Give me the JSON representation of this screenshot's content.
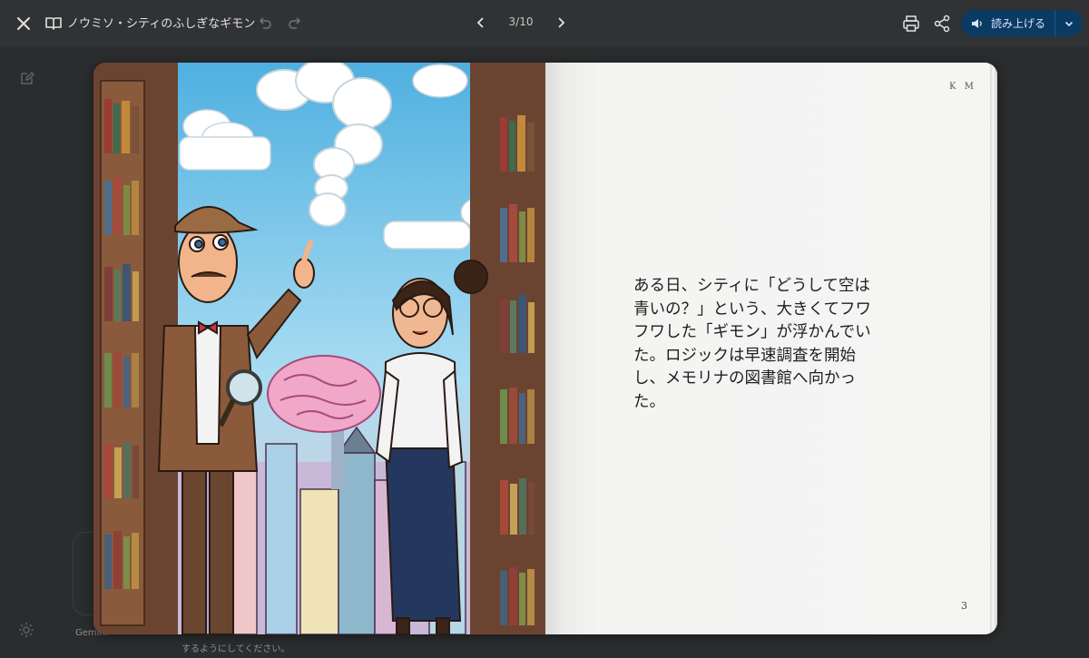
{
  "toolbar": {
    "title": "ノウミソ・シティのふしぎなギモン",
    "page_counter": "3/10",
    "read_aloud_label": "読み上げる"
  },
  "book": {
    "author_initials": "K M",
    "story_lines": [
      "ある日、シティに「どうして空は",
      "青いの？」という、大きくてフワ",
      "フワした「ギモン」が浮かんでい",
      "た。ロジックは早速調査を開始",
      "し、メモリナの図書館へ向かっ",
      "た。"
    ],
    "page_number": "3"
  },
  "background": {
    "footer_prefix": "Gemini",
    "footer_line2": "するようにしてください。"
  },
  "colors": {
    "topbar": "#303234",
    "background": "#2a2c2e",
    "accent_button": "#0b3a63"
  }
}
